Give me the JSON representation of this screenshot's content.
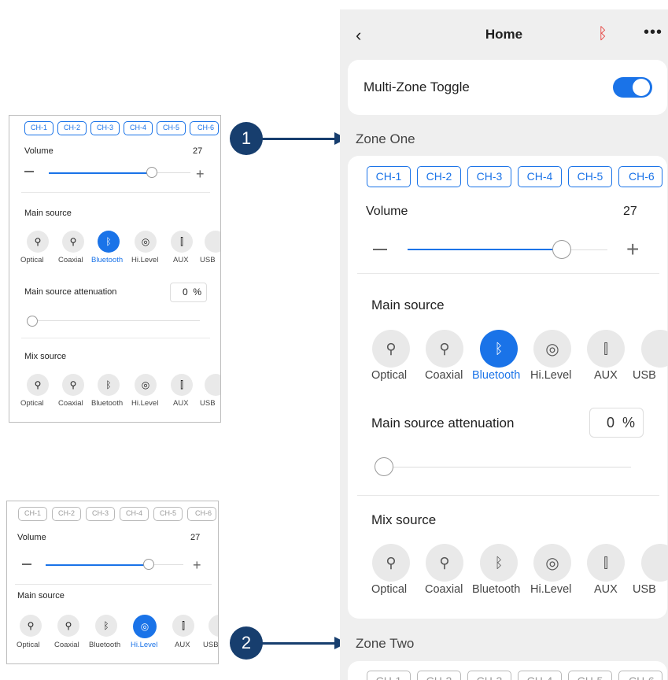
{
  "nav": {
    "title": "Home"
  },
  "multizone": {
    "label": "Multi-Zone Toggle",
    "on": true
  },
  "zones": {
    "one": "Zone One",
    "two": "Zone Two"
  },
  "channels": [
    "CH-1",
    "CH-2",
    "CH-3",
    "CH-4",
    "CH-5",
    "CH-6"
  ],
  "volume": {
    "label": "Volume",
    "value": "27"
  },
  "main_source": {
    "label": "Main source",
    "items": [
      "Optical",
      "Coaxial",
      "Bluetooth",
      "Hi.Level",
      "AUX",
      "USB"
    ],
    "selected": "Bluetooth"
  },
  "attenuation": {
    "label": "Main source attenuation",
    "value": "0",
    "unit": "%"
  },
  "mix_source": {
    "label": "Mix source",
    "items": [
      "Optical",
      "Coaxial",
      "Bluetooth",
      "Hi.Level",
      "AUX",
      "USB"
    ]
  },
  "thumb2": {
    "selected": "Hi.Level"
  },
  "callouts": [
    "1",
    "2"
  ],
  "colors": {
    "accent": "#1a73e8",
    "bluetooth_status": "#e53935",
    "callout": "#173e6e"
  }
}
